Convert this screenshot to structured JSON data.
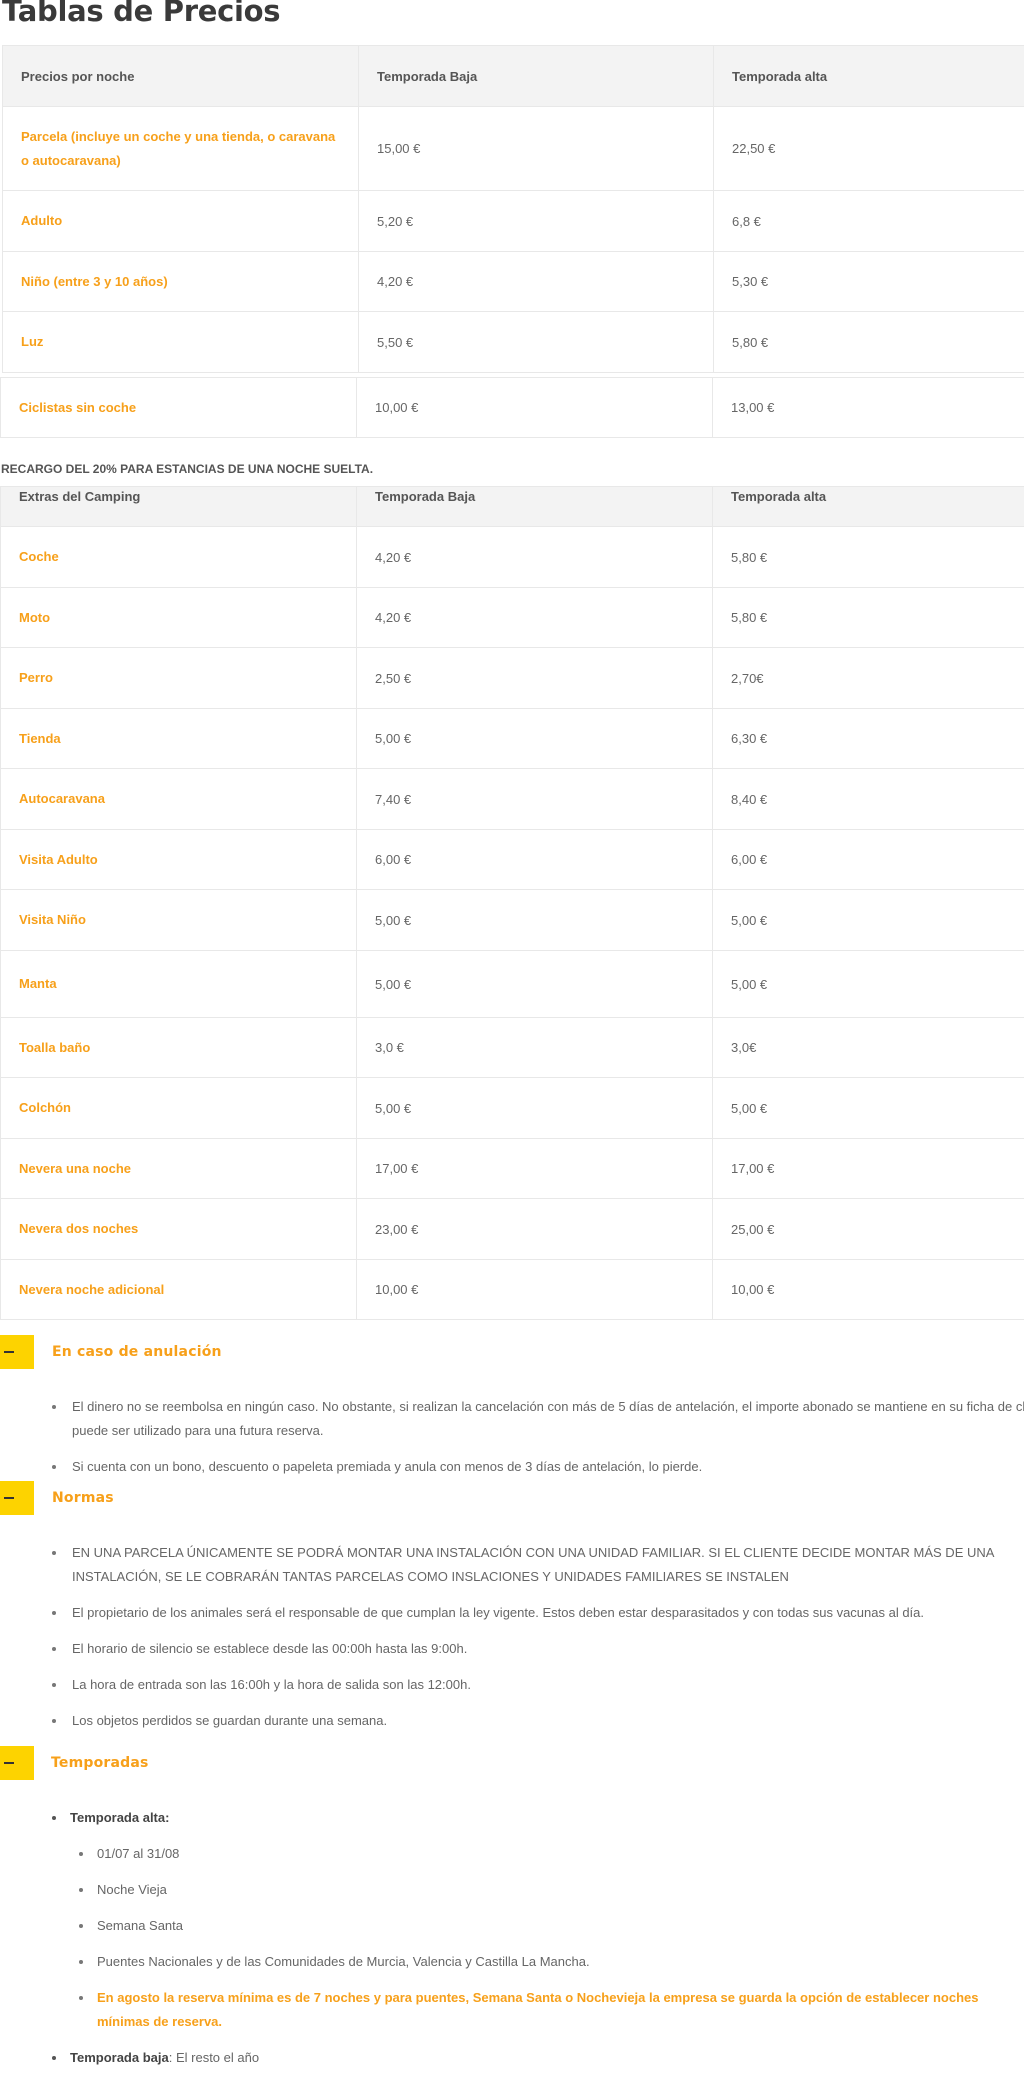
{
  "page": {
    "title": "Tablas de Precios"
  },
  "prices_table": {
    "headers": [
      "Precios por noche",
      "Temporada Baja",
      "Temporada alta"
    ],
    "rows": [
      {
        "name": "Parcela (incluye un coche y una tienda, o caravana o autocaravana)",
        "low": "15,00 €",
        "high": "22,50 €"
      },
      {
        "name": "Adulto",
        "low": "5,20 €",
        "high": "6,8 €"
      },
      {
        "name": "Niño (entre 3 y 10 años)",
        "low": "4,20 €",
        "high": "5,30 €"
      },
      {
        "name": "Luz",
        "low": "5,50 €",
        "high": "5,80 €"
      }
    ]
  },
  "cyclists_table": {
    "rows": [
      {
        "name": "Ciclistas sin coche",
        "low": "10,00 €",
        "high": "13,00 €"
      }
    ]
  },
  "surcharge_note": "RECARGO DEL 20% PARA ESTANCIAS DE UNA NOCHE SUELTA.",
  "extras_table": {
    "headers": [
      "Extras del Camping",
      "Temporada Baja",
      "Temporada alta"
    ],
    "rows": [
      {
        "name": "Coche",
        "low": "4,20 €",
        "high": "5,80 €"
      },
      {
        "name": "Moto",
        "low": "4,20 €",
        "high": "5,80 €"
      },
      {
        "name": "Perro",
        "low": "2,50 €",
        "high": "2,70€"
      },
      {
        "name": "Tienda",
        "low": "5,00 €",
        "high": "6,30 €"
      },
      {
        "name": "Autocaravana",
        "low": "7,40 €",
        "high": "8,40 €"
      },
      {
        "name": "Visita Adulto",
        "low": "6,00 €",
        "high": "6,00 €"
      },
      {
        "name": "Visita Niño",
        "low": "5,00 €",
        "high": "5,00 €"
      },
      {
        "name": "Manta",
        "low": "5,00 €",
        "high": "5,00 €"
      },
      {
        "name": "Toalla baño",
        "low": "3,0 €",
        "high": "3,0€"
      },
      {
        "name": "Colchón",
        "low": "5,00 €",
        "high": "5,00 €"
      },
      {
        "name": "Nevera una noche",
        "low": "17,00 €",
        "high": "17,00 €"
      },
      {
        "name": "Nevera dos noches",
        "low": "23,00 €",
        "high": "25,00 €"
      },
      {
        "name": "Nevera noche adicional",
        "low": "10,00 €",
        "high": "10,00 €"
      }
    ]
  },
  "accordions": {
    "cancellation": {
      "title": "En caso de anulación",
      "items": [
        "El dinero no se reembolsa en ningún caso. No obstante, si realizan la cancelación con más de 5 días de antelación, el importe abonado se mantiene en su ficha de cliente y puede ser utilizado para una futura reserva.",
        "Si cuenta con un bono, descuento o papeleta premiada y anula con menos de 3 días de antelación, lo pierde."
      ]
    },
    "rules": {
      "title": "Normas",
      "items": [
        "EN UNA PARCELA ÚNICAMENTE SE PODRÁ MONTAR UNA INSTALACIÓN CON UNA UNIDAD FAMILIAR. SI EL CLIENTE DECIDE MONTAR MÁS DE UNA INSTALACIÓN, SE LE COBRARÁN TANTAS PARCELAS COMO INSLACIONES Y UNIDADES FAMILIARES SE INSTALEN",
        "El propietario de los animales será el responsable de que cumplan la ley vigente. Estos deben estar desparasitados y con todas sus vacunas al día.",
        "El horario de silencio se establece desde las 00:00h hasta las 9:00h.",
        "La hora de entrada son las 16:00h y la hora de salida son las 12:00h.",
        "Los objetos perdidos se guardan durante una semana."
      ]
    },
    "seasons": {
      "title": "Temporadas",
      "high_label": "Temporada alta:",
      "high_items": [
        "01/07 al 31/08",
        "Noche Vieja",
        "Semana Santa",
        "Puentes Nacionales y de las Comunidades de Murcia, Valencia y Castilla La Mancha."
      ],
      "high_note": "En agosto la reserva mínima es de 7 noches y para puentes, Semana Santa o Nochevieja la empresa se guarda la opción de establecer noches mínimas de reserva.",
      "low_label": "Temporada baja",
      "low_text": ": El resto el año"
    }
  },
  "colors": {
    "accent_orange": "#f7a01a",
    "toggle_yellow": "#fdd300",
    "header_bg": "#f3f3f3"
  }
}
